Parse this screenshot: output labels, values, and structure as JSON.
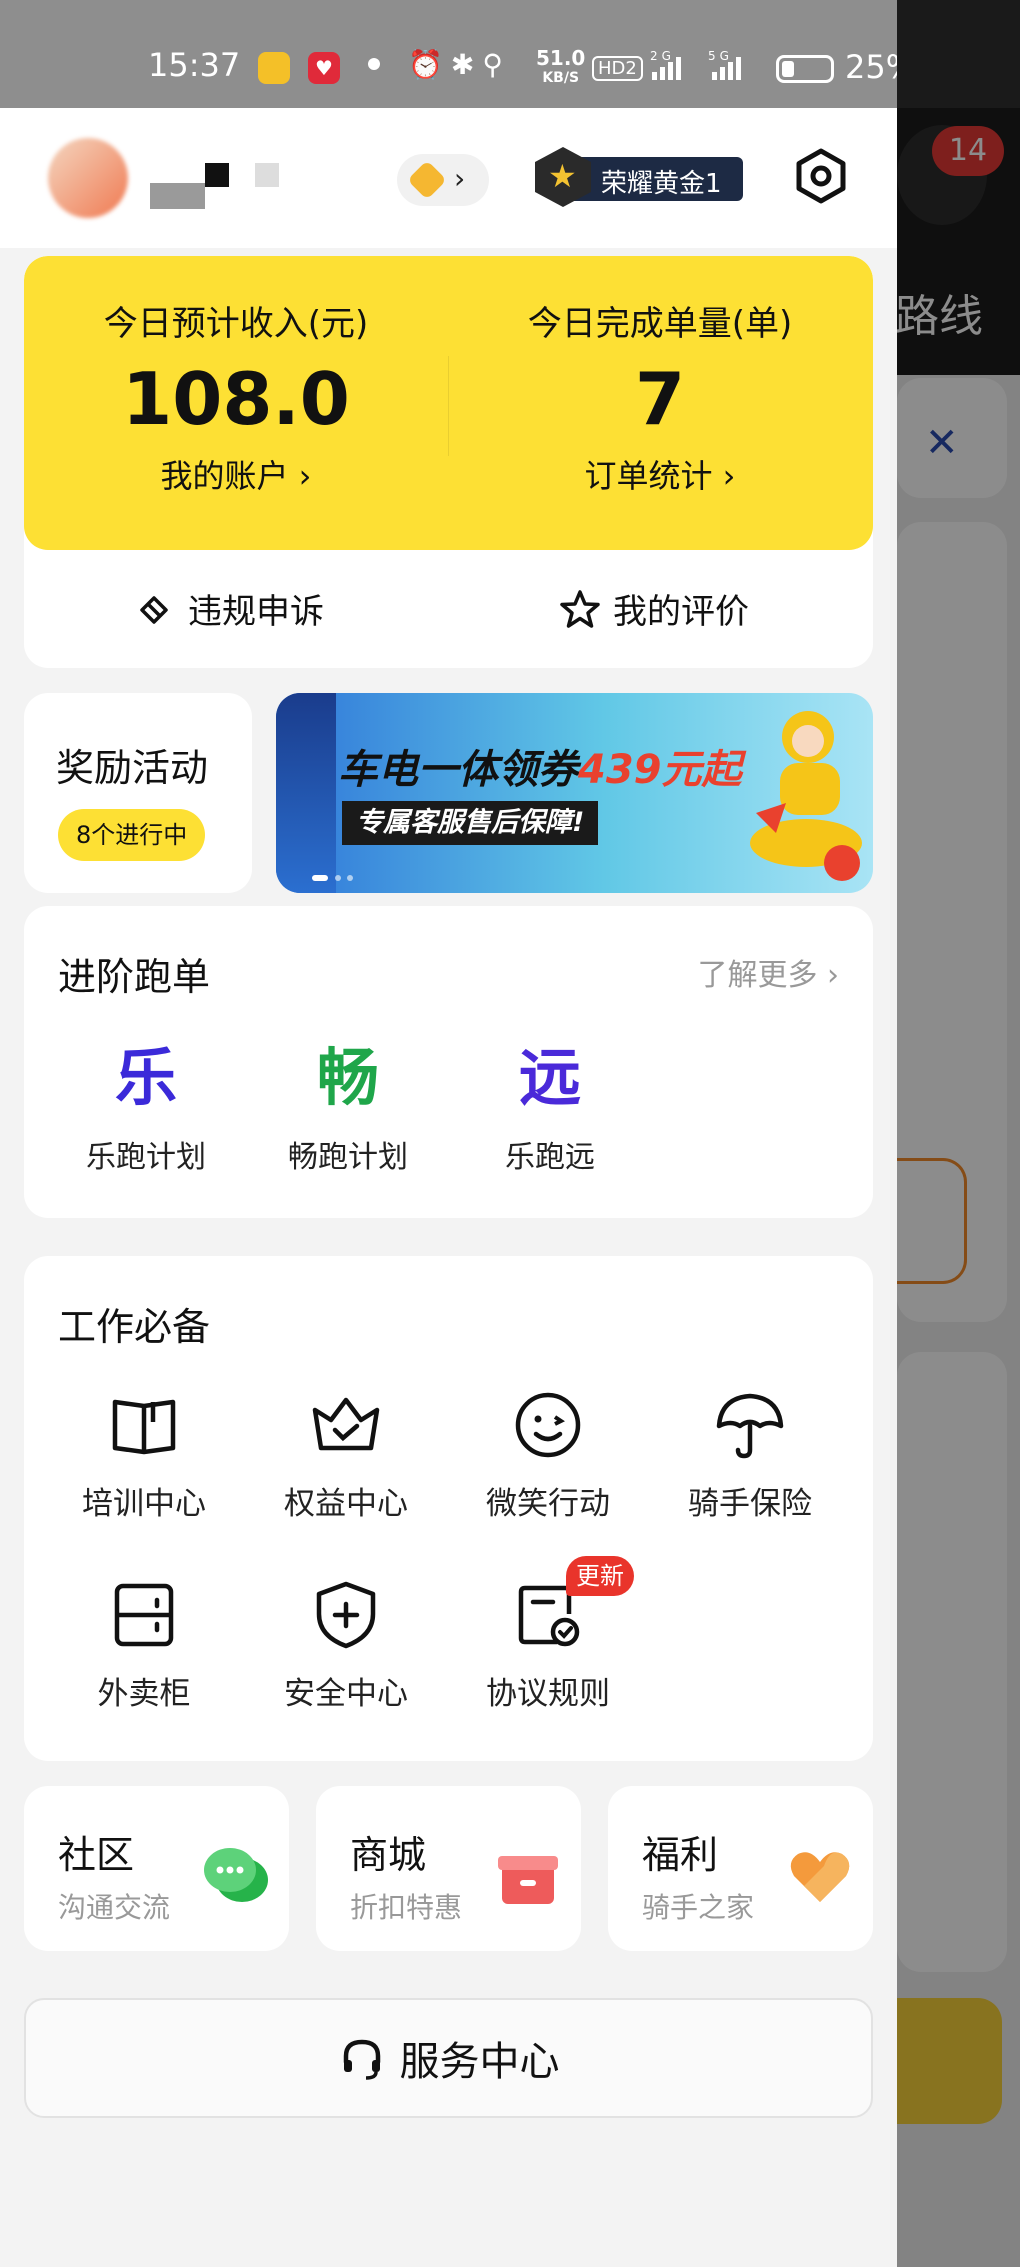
{
  "status_bar": {
    "time": "15:37",
    "net_speed_value": "51.0",
    "net_speed_unit": "KB/S",
    "hd_label": "HD2",
    "network_2g": "2G",
    "network_5g": "5G",
    "battery_pct": "25%"
  },
  "header": {
    "rank_label": "荣耀黄金1"
  },
  "earnings": {
    "income_label": "今日预计收入(元)",
    "income_value": "108.0",
    "account_link": "我的账户 ›",
    "orders_label": "今日完成单量(单)",
    "orders_value": "7",
    "orders_link": "订单统计 ›",
    "appeal_label": "违规申诉",
    "review_label": "我的评价"
  },
  "rewards": {
    "title": "奖励活动",
    "badge": "8个进行中"
  },
  "banner": {
    "headline_prefix": "车电一体领券",
    "headline_amount": "439元起",
    "subline": "专属客服售后保障!"
  },
  "advanced": {
    "title": "进阶跑单",
    "more_label": "了解更多 ›",
    "items": [
      {
        "char": "乐",
        "label": "乐跑计划",
        "color": "#3b2ad9"
      },
      {
        "char": "畅",
        "label": "畅跑计划",
        "color": "#1fa64a"
      },
      {
        "char": "远",
        "label": "乐跑远",
        "color": "#4a2ad9"
      }
    ]
  },
  "tools": {
    "title": "工作必备",
    "items": [
      {
        "label": "培训中心",
        "icon": "book-icon"
      },
      {
        "label": "权益中心",
        "icon": "crown-icon"
      },
      {
        "label": "微笑行动",
        "icon": "smile-icon"
      },
      {
        "label": "骑手保险",
        "icon": "umbrella-icon"
      },
      {
        "label": "外卖柜",
        "icon": "locker-icon"
      },
      {
        "label": "安全中心",
        "icon": "shield-icon"
      },
      {
        "label": "协议规则",
        "icon": "document-check-icon",
        "badge": "更新"
      }
    ]
  },
  "mini_cards": [
    {
      "title": "社区",
      "subtitle": "沟通交流",
      "icon": "chat-icon"
    },
    {
      "title": "商城",
      "subtitle": "折扣特惠",
      "icon": "gift-icon"
    },
    {
      "title": "福利",
      "subtitle": "骑手之家",
      "icon": "heart-icon"
    }
  ],
  "service": {
    "label": "服务中心"
  },
  "background": {
    "notification_count": "14",
    "route_label": "路线"
  },
  "colors": {
    "accent_yellow": "#fde034",
    "badge_red": "#e9342b"
  }
}
